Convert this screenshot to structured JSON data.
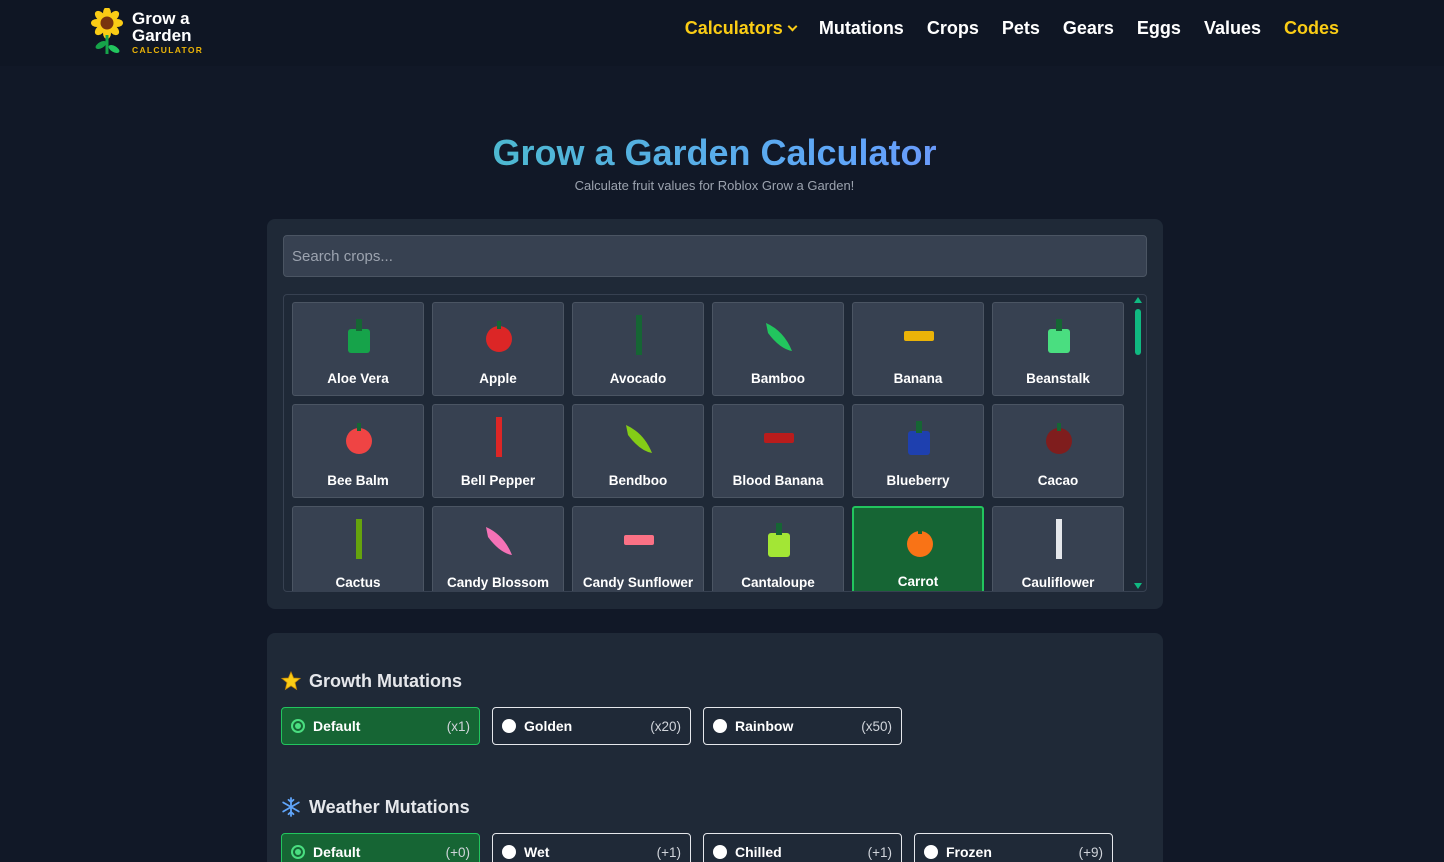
{
  "header": {
    "logo": {
      "line1": "Grow a",
      "line2": "Garden",
      "sub": "CALCULATOR",
      "icon": "sunflower-icon"
    },
    "nav": [
      {
        "label": "Calculators",
        "dropdown": true,
        "color": "#facc15"
      },
      {
        "label": "Mutations"
      },
      {
        "label": "Crops"
      },
      {
        "label": "Pets"
      },
      {
        "label": "Gears"
      },
      {
        "label": "Eggs"
      },
      {
        "label": "Values"
      },
      {
        "label": "Codes",
        "color": "#facc15"
      }
    ]
  },
  "hero": {
    "title": "Grow a Garden Calculator",
    "subtitle": "Calculate fruit values for Roblox Grow a Garden!"
  },
  "search": {
    "placeholder": "Search crops..."
  },
  "crops": [
    {
      "name": "Aloe Vera",
      "color": "#16a34a"
    },
    {
      "name": "Apple",
      "color": "#dc2626"
    },
    {
      "name": "Avocado",
      "color": "#166534"
    },
    {
      "name": "Bamboo",
      "color": "#22c55e"
    },
    {
      "name": "Banana",
      "color": "#eab308"
    },
    {
      "name": "Beanstalk",
      "color": "#4ade80"
    },
    {
      "name": "Bee Balm",
      "color": "#ef4444"
    },
    {
      "name": "Bell Pepper",
      "color": "#dc2626"
    },
    {
      "name": "Bendboo",
      "color": "#84cc16"
    },
    {
      "name": "Blood Banana",
      "color": "#b91c1c"
    },
    {
      "name": "Blueberry",
      "color": "#1e40af"
    },
    {
      "name": "Cacao",
      "color": "#7f1d1d"
    },
    {
      "name": "Cactus",
      "color": "#65a30d"
    },
    {
      "name": "Candy Blossom",
      "color": "#f472b6"
    },
    {
      "name": "Candy Sunflower",
      "color": "#fb7185"
    },
    {
      "name": "Cantaloupe",
      "color": "#a3e635"
    },
    {
      "name": "Carrot",
      "color": "#f97316",
      "selected": true
    },
    {
      "name": "Cauliflower",
      "color": "#e5e7eb"
    }
  ],
  "mutations": {
    "growth": {
      "title": "Growth Mutations",
      "icon": "star-icon",
      "options": [
        {
          "label": "Default",
          "mult": "(x1)",
          "selected": true
        },
        {
          "label": "Golden",
          "mult": "(x20)"
        },
        {
          "label": "Rainbow",
          "mult": "(x50)"
        }
      ]
    },
    "weather": {
      "title": "Weather Mutations",
      "icon": "snowflake-icon",
      "options": [
        {
          "label": "Default",
          "mult": "(+0)",
          "selected": true
        },
        {
          "label": "Wet",
          "mult": "(+1)"
        },
        {
          "label": "Chilled",
          "mult": "(+1)"
        },
        {
          "label": "Frozen",
          "mult": "(+9)"
        }
      ]
    }
  },
  "colors": {
    "accent": "#22c55e",
    "gold": "#facc15",
    "bg": "#111827",
    "panel": "#1f2937"
  }
}
